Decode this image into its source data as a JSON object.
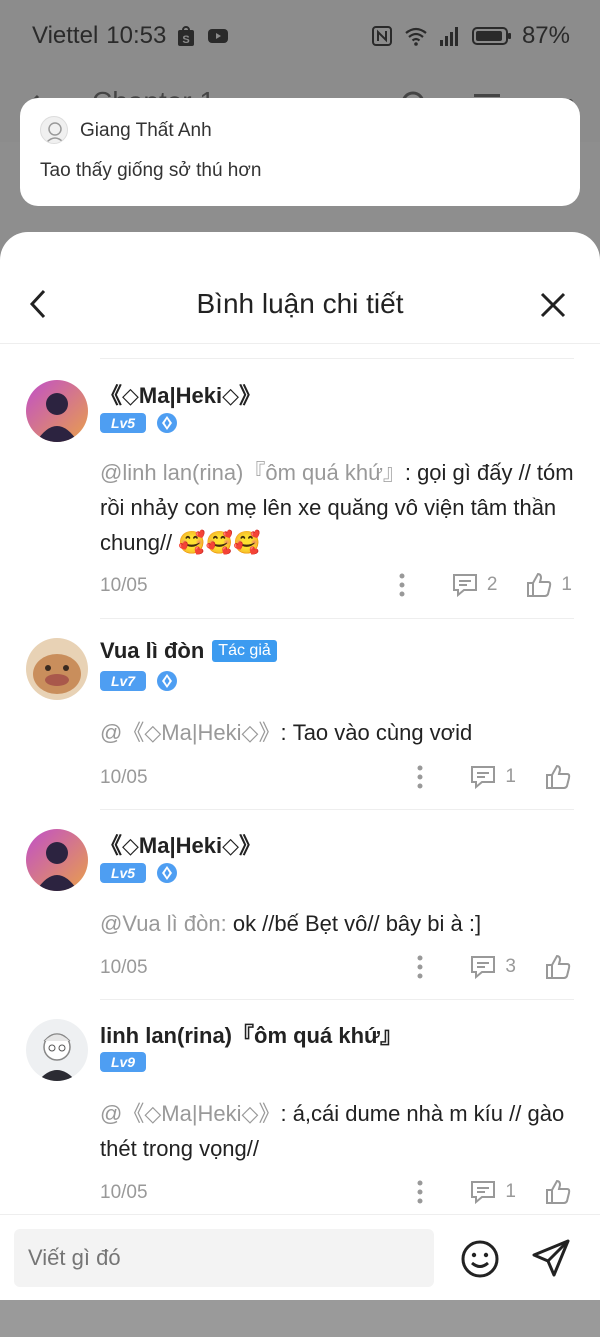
{
  "status_bar": {
    "carrier": "Viettel",
    "time": "10:53",
    "battery": "87%",
    "icons": [
      "shopee-icon",
      "youtube-icon",
      "nfc-icon",
      "wifi-icon",
      "signal-icon",
      "battery-icon"
    ]
  },
  "background_header": {
    "title": "Chapter 1"
  },
  "notification": {
    "sender": "Giang Thất Anh",
    "message": "Tao thấy giống sở thú hơn"
  },
  "sheet": {
    "title": "Bình luận chi tiết"
  },
  "comments": [
    {
      "author": "《◇Ma|Heki◇》",
      "level": "Lv5",
      "mention": "@linh lan(rina)『ôm quá khứ』",
      "text": ": gọi gì đấy // tóm rồi nhảy con mẹ lên xe quăng vô viện tâm thần chung// 🥰🥰🥰",
      "date": "10/05",
      "reply_count": "2",
      "like_count": "1"
    },
    {
      "author": "Vua lì đòn",
      "author_tag": "Tác giả",
      "level": "Lv7",
      "mention": "@《◇Ma|Heki◇》",
      "text": ": Tao vào cùng vơid",
      "date": "10/05",
      "reply_count": "1",
      "like_count": ""
    },
    {
      "author": "《◇Ma|Heki◇》",
      "level": "Lv5",
      "mention": "@Vua lì đòn:",
      "text": " ok //bế Bẹt vô// bây bi à :]",
      "date": "10/05",
      "reply_count": "3",
      "like_count": ""
    },
    {
      "author": "linh lan(rina)『ôm quá khứ』",
      "level": "Lv9",
      "mention": "@《◇Ma|Heki◇》",
      "text": ": á,cái dume nhà m kíu // gào thét trong vọng//",
      "date": "10/05",
      "reply_count": "1",
      "like_count": ""
    }
  ],
  "input": {
    "placeholder": "Viết gì đó"
  },
  "colors": {
    "accent": "#3c9bf0",
    "level_badge": "#4e9ef2",
    "overlay": "#8c8c8c",
    "muted_text": "#999999"
  }
}
